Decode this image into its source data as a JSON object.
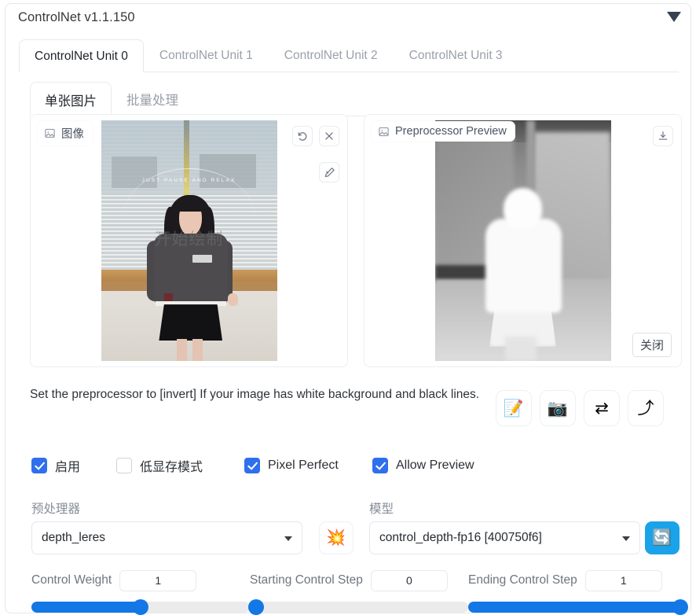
{
  "panel": {
    "title": "ControlNet v1.1.150",
    "collapse_icon": "triangle-down-icon"
  },
  "unit_tabs": [
    {
      "label": "ControlNet Unit 0",
      "active": true
    },
    {
      "label": "ControlNet Unit 1",
      "active": false
    },
    {
      "label": "ControlNet Unit 2",
      "active": false
    },
    {
      "label": "ControlNet Unit 3",
      "active": false
    }
  ],
  "mode_tabs": [
    {
      "label": "单张图片",
      "active": true
    },
    {
      "label": "批量处理",
      "active": false
    }
  ],
  "image_panel": {
    "chip_label": "图像",
    "chip_icon": "image-icon",
    "watermark": "开始绘制",
    "photo_arc_text": "JUST PAUSE AND RELAX",
    "buttons": {
      "undo": "undo-icon",
      "close": "close-icon",
      "edit": "pencil-edit-icon"
    }
  },
  "preview_panel": {
    "chip_label": "Preprocessor Preview",
    "chip_icon": "image-icon",
    "download_icon": "download-icon",
    "close_label": "关闭"
  },
  "hint": {
    "text": "Set the preprocessor to [invert] If your image has white background and black lines."
  },
  "action_buttons": [
    {
      "name": "open-new-canvas-button",
      "glyph": "📝"
    },
    {
      "name": "webcam-button",
      "glyph": "📷"
    },
    {
      "name": "swap-button",
      "glyph": "⇄"
    },
    {
      "name": "send-dimensions-button",
      "glyph": "⤴"
    }
  ],
  "checkboxes": [
    {
      "label": "启用",
      "checked": true
    },
    {
      "label": "低显存模式",
      "checked": false
    },
    {
      "label": "Pixel Perfect",
      "checked": true
    },
    {
      "label": "Allow Preview",
      "checked": true
    }
  ],
  "preprocessor": {
    "label": "预处理器",
    "value": "depth_leres",
    "run_button_glyph": "💥"
  },
  "model": {
    "label": "模型",
    "value": "control_depth-fp16 [400750f6]",
    "refresh_button_glyph": "🔄"
  },
  "sliders": [
    {
      "label": "Control Weight",
      "value": "1",
      "fill_pct": 50,
      "thumb_pct": 50
    },
    {
      "label": "Starting Control Step",
      "value": "0",
      "fill_pct": 0,
      "thumb_pct": 2
    },
    {
      "label": "Ending Control Step",
      "value": "1",
      "fill_pct": 100,
      "thumb_pct": 98
    }
  ],
  "colors": {
    "accent_blue": "#1477e6",
    "checkbox_blue": "#2f6fed",
    "refresh_blue": "#1aa3e8",
    "border": "#e6e8ec",
    "text": "#2b3036",
    "muted": "#9aa0ab"
  }
}
